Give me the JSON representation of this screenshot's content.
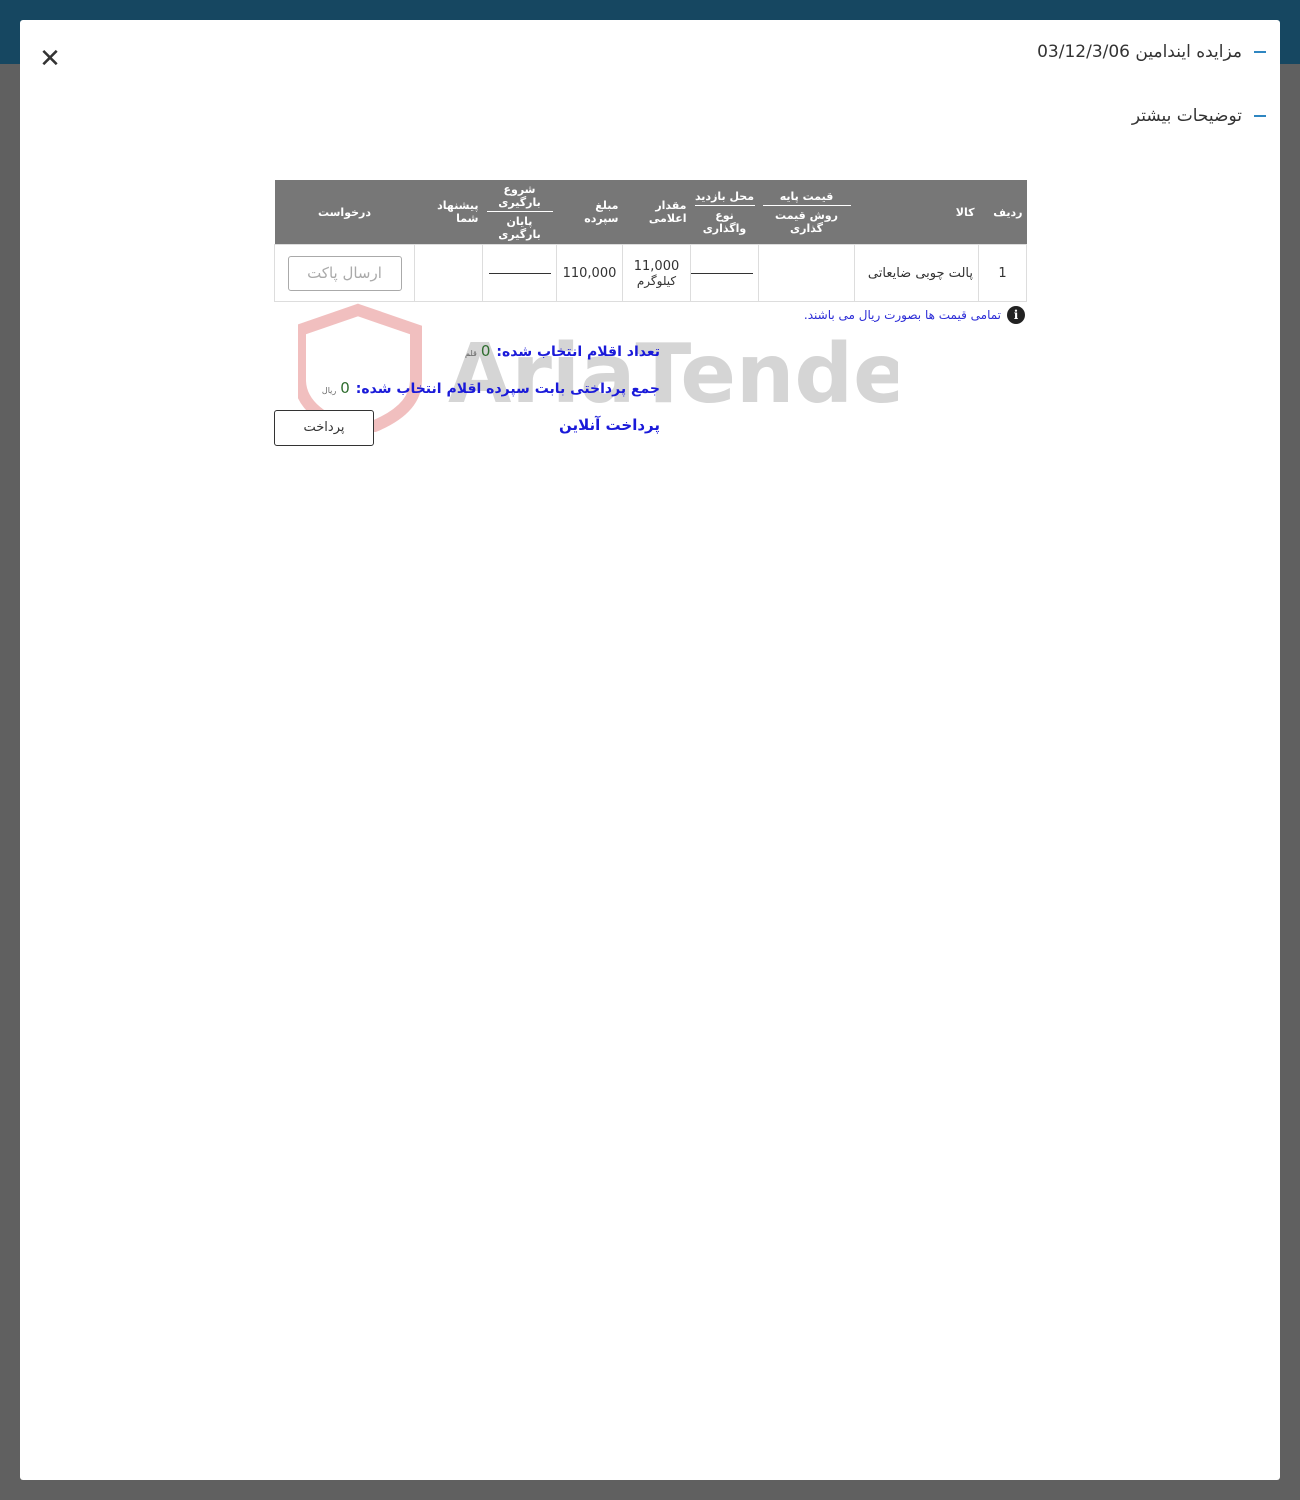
{
  "header": {
    "title": "مزایده ایندامین 03/12/3/06",
    "subtitle": "توضیحات بیشتر"
  },
  "table": {
    "headers": {
      "row": "ردیف",
      "item": "کالا",
      "base_price": "قیمت پایه",
      "pricing_method": "روش قیمت گذاری",
      "visit_place": "محل بازدید",
      "assign_type": "نوع واگذاری",
      "quantity": "مقدار اعلامی",
      "deposit": "مبلغ سپرده",
      "load_start": "شروع بارگیری",
      "load_end": "پایان بارگیری",
      "your_offer": "پیشنهاد شما",
      "request": "درخواست"
    },
    "rows": [
      {
        "row": "1",
        "item": "پالت چوبی ضایعاتی",
        "base_price": "",
        "quantity": "11,000",
        "quantity_unit": "کیلوگرم",
        "deposit": "110,000",
        "your_offer": "",
        "request_button": "ارسال پاکت"
      }
    ]
  },
  "note": {
    "text": "تمامی قیمت ها بصورت ریال می باشند.",
    "icon": "info-icon"
  },
  "watermark": "AriaTender.neT",
  "summary": {
    "count_label": "تعداد اقلام انتخاب شده:",
    "count_value": "0",
    "count_unit": "قلم",
    "total_label": "جمع پرداختی بابت سپرده اقلام انتخاب شده:",
    "total_value": "0",
    "total_unit": "ریال"
  },
  "online_payment": "پرداخت آنلاین",
  "pay_button": "پرداخت",
  "colors": {
    "topbar": "#164761",
    "accent": "#2e86c1",
    "link": "#1a1ad9",
    "header_bg": "#777777"
  }
}
